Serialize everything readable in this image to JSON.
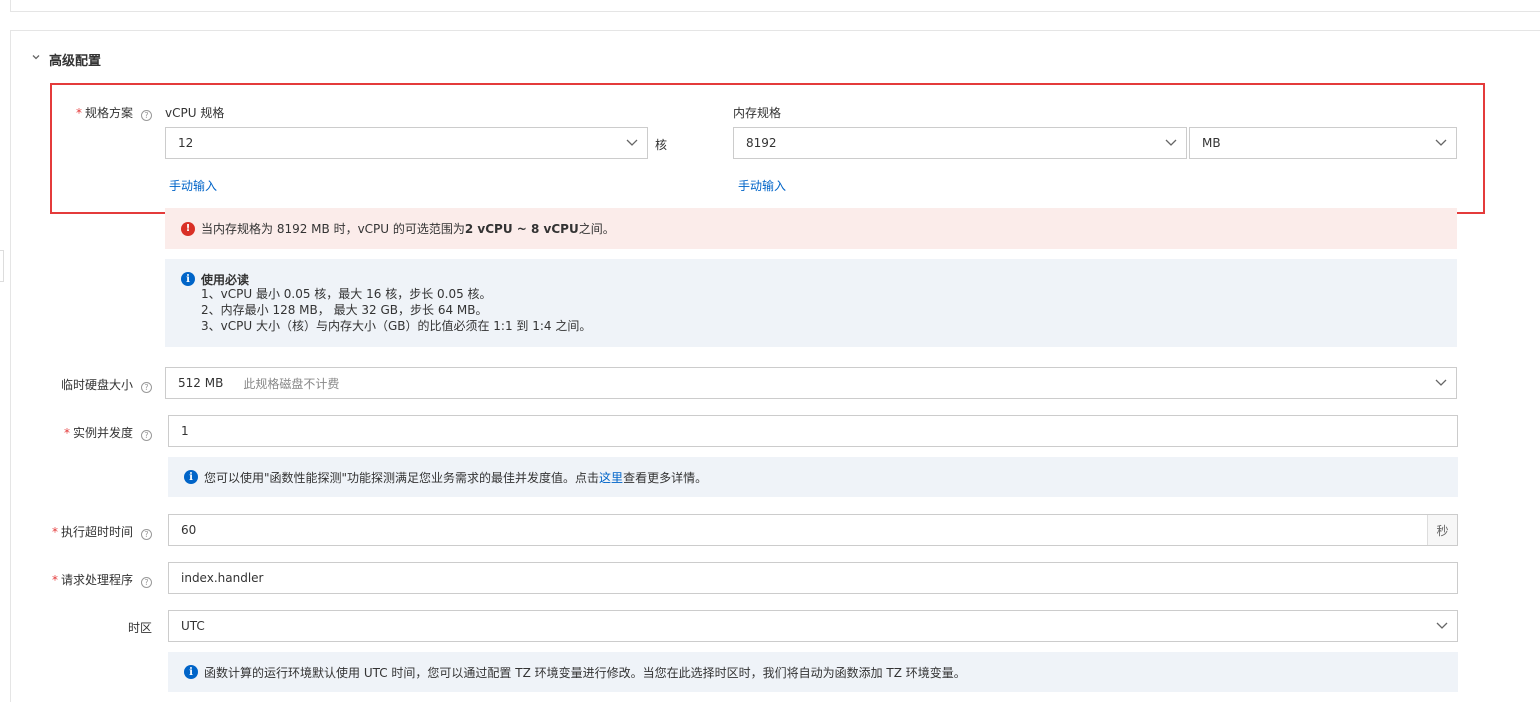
{
  "section": {
    "title": "高级配置"
  },
  "spec": {
    "label": "规格方案",
    "vcpu": {
      "label": "vCPU 规格",
      "value": "12",
      "unit": "核",
      "manual_link": "手动输入"
    },
    "memory": {
      "label": "内存规格",
      "value": "8192",
      "unit_value": "MB",
      "manual_link": "手动输入"
    }
  },
  "error": {
    "prefix": "当内存规格为 8192 MB 时，vCPU 的可选范围为 ",
    "range": "2 vCPU ~ 8 vCPU",
    "suffix": " 之间。"
  },
  "notice": {
    "title": "使用必读",
    "lines": [
      "1、vCPU 最小 0.05 核，最大 16 核，步长 0.05 核。",
      "2、内存最小 128 MB， 最大 32 GB，步长 64 MB。",
      "3、vCPU 大小（核）与内存大小（GB）的比值必须在 1:1 到 1:4 之间。"
    ]
  },
  "disk": {
    "label": "临时硬盘大小",
    "value": "512 MB",
    "hint": "此规格磁盘不计费"
  },
  "concurrency": {
    "label": "实例并发度",
    "value": "1",
    "info_prefix": "您可以使用\"函数性能探测\"功能探测满足您业务需求的最佳并发度值。点击",
    "info_link": "这里",
    "info_suffix": "查看更多详情。"
  },
  "timeout": {
    "label": "执行超时时间",
    "value": "60",
    "unit": "秒"
  },
  "handler": {
    "label": "请求处理程序",
    "value": "index.handler"
  },
  "timezone": {
    "label": "时区",
    "value": "UTC",
    "info": "函数计算的运行环境默认使用 UTC 时间，您可以通过配置 TZ 环境变量进行修改。当您在此选择时区时，我们将自动为函数添加 TZ 环境变量。"
  },
  "icons": {
    "collapse": "chevron-down-icon",
    "help": "question-circle-icon",
    "dropdown": "chevron-down-icon",
    "error": "exclamation-circle-icon",
    "info": "info-circle-icon"
  },
  "colors": {
    "accent": "#0064c8",
    "error": "#d93026",
    "highlight": "#e43b3b"
  }
}
